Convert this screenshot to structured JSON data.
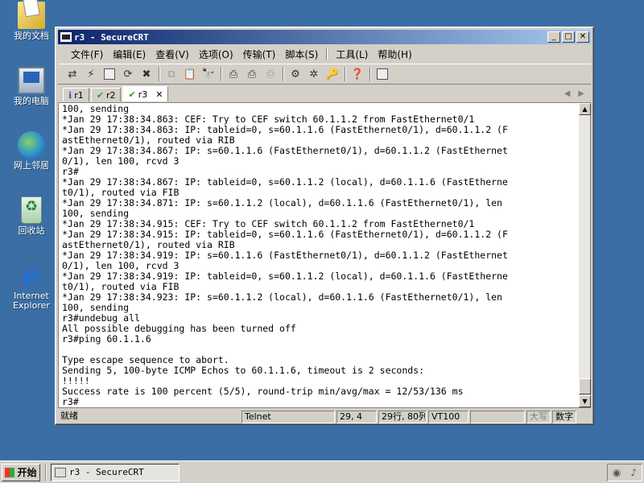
{
  "desktop": {
    "icons": [
      {
        "label": "我的文档",
        "icon": "my-documents-icon"
      },
      {
        "label": "我的电脑",
        "icon": "my-computer-icon"
      },
      {
        "label": "网上邻居",
        "icon": "network-places-icon"
      },
      {
        "label": "回收站",
        "icon": "recycle-bin-icon"
      },
      {
        "label": "Internet Explorer",
        "icon": "internet-explorer-icon"
      }
    ]
  },
  "window": {
    "title": "r3 - SecureCRT",
    "controls": {
      "minimize": "_",
      "maximize": "□",
      "close": "✕"
    }
  },
  "menu": [
    "文件(F)",
    "编辑(E)",
    "查看(V)",
    "选项(O)",
    "传输(T)",
    "脚本(S)",
    "工具(L)",
    "帮助(H)"
  ],
  "tabs": [
    {
      "label": "r1",
      "status": "info"
    },
    {
      "label": "r2",
      "status": "connected"
    },
    {
      "label": "r3",
      "status": "connected",
      "active": true,
      "close": "✕"
    }
  ],
  "terminal": {
    "lines": [
      "100, sending",
      "*Jan 29 17:38:34.863: CEF: Try to CEF switch 60.1.1.2 from FastEthernet0/1",
      "*Jan 29 17:38:34.863: IP: tableid=0, s=60.1.1.6 (FastEthernet0/1), d=60.1.1.2 (F",
      "astEthernet0/1), routed via RIB",
      "*Jan 29 17:38:34.867: IP: s=60.1.1.6 (FastEthernet0/1), d=60.1.1.2 (FastEthernet",
      "0/1), len 100, rcvd 3",
      "r3#",
      "*Jan 29 17:38:34.867: IP: tableid=0, s=60.1.1.2 (local), d=60.1.1.6 (FastEtherne",
      "t0/1), routed via FIB",
      "*Jan 29 17:38:34.871: IP: s=60.1.1.2 (local), d=60.1.1.6 (FastEthernet0/1), len",
      "100, sending",
      "*Jan 29 17:38:34.915: CEF: Try to CEF switch 60.1.1.2 from FastEthernet0/1",
      "*Jan 29 17:38:34.915: IP: tableid=0, s=60.1.1.6 (FastEthernet0/1), d=60.1.1.2 (F",
      "astEthernet0/1), routed via RIB",
      "*Jan 29 17:38:34.919: IP: s=60.1.1.6 (FastEthernet0/1), d=60.1.1.2 (FastEthernet",
      "0/1), len 100, rcvd 3",
      "*Jan 29 17:38:34.919: IP: tableid=0, s=60.1.1.2 (local), d=60.1.1.6 (FastEtherne",
      "t0/1), routed via FIB",
      "*Jan 29 17:38:34.923: IP: s=60.1.1.2 (local), d=60.1.1.6 (FastEthernet0/1), len",
      "100, sending",
      "r3#undebug all",
      "All possible debugging has been turned off",
      "r3#ping 60.1.1.6",
      "",
      "Type escape sequence to abort.",
      "Sending 5, 100-byte ICMP Echos to 60.1.1.6, timeout is 2 seconds:",
      "!!!!!",
      "Success rate is 100 percent (5/5), round-trip min/avg/max = 12/53/136 ms",
      "r3#"
    ]
  },
  "status": {
    "ready": "就绪",
    "protocol": "Telnet",
    "cursor": "29, 4",
    "size": "29行, 80列",
    "emulation": "VT100",
    "blank": "",
    "caps": "大写",
    "num": "数字"
  },
  "taskbar": {
    "start": "开始",
    "task": "r3 - SecureCRT"
  }
}
